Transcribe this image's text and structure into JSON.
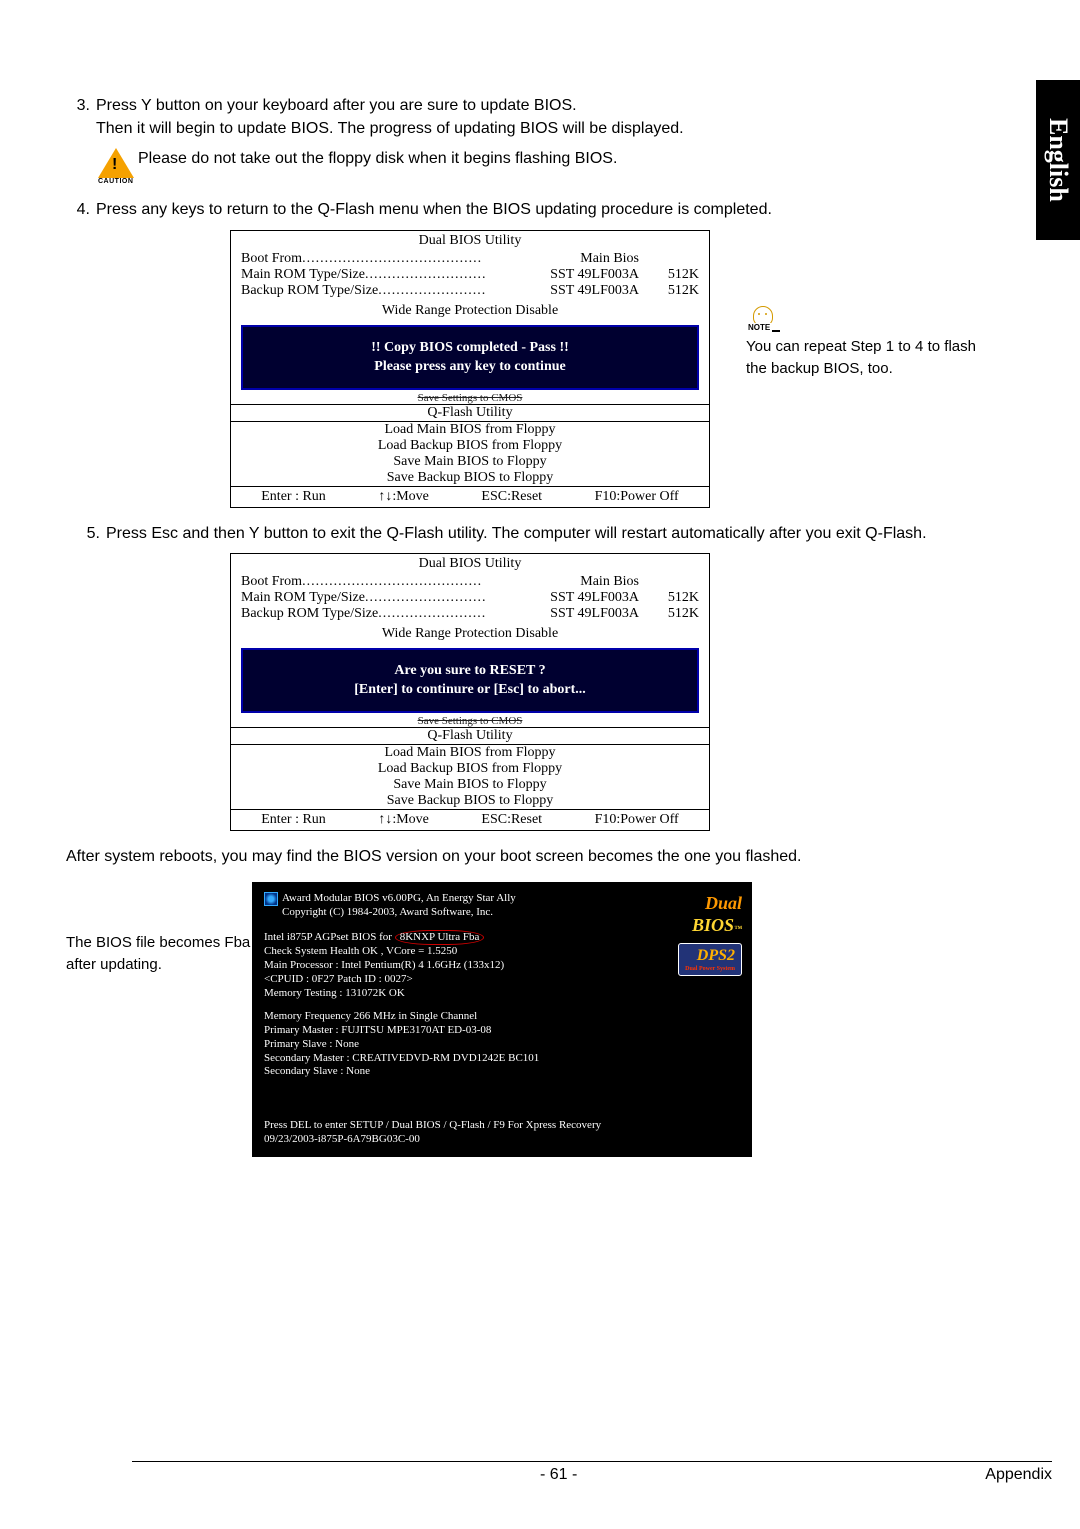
{
  "sideTab": "English",
  "steps": {
    "s3": {
      "num": "3.",
      "text": "Press Y button on your keyboard after you are sure to update BIOS.\nThen it will begin to update BIOS. The progress of updating BIOS will be displayed."
    },
    "caution": "Please do not take out the floppy disk when it begins flashing BIOS.",
    "cautionLabel": "CAUTION",
    "s4": {
      "num": "4.",
      "text": "Press any keys to return to the Q-Flash menu when the BIOS updating procedure is completed."
    },
    "s5": {
      "num": "5.",
      "text": "Press Esc and then Y button to exit the Q-Flash utility. The computer will restart automatically after you exit Q-Flash."
    }
  },
  "bios": {
    "title": "Dual BIOS Utility",
    "boot": {
      "l": "Boot From",
      "c": "Main Bios"
    },
    "main": {
      "l": "Main ROM Type/Size",
      "c": "SST 49LF003A",
      "r": "512K"
    },
    "backup": {
      "l": "Backup ROM Type/Size",
      "c": "SST 49LF003A",
      "r": "512K"
    },
    "wrp": "Wide Range Protection    Disable",
    "banner1": {
      "a": "!! Copy BIOS completed - Pass !!",
      "b": "Please press any key to continue"
    },
    "banner2": {
      "a": "Are you sure to RESET ?",
      "b": "[Enter] to continure or [Esc] to abort..."
    },
    "strike": "Save Settings to CMOS",
    "qflash": "Q-Flash Utility",
    "m1": "Load Main BIOS from Floppy",
    "m2": "Load Backup BIOS from Floppy",
    "m3": "Save Main BIOS to Floppy",
    "m4": "Save Backup BIOS to Floppy",
    "f": {
      "a": "Enter : Run",
      "b": "↑↓:Move",
      "c": "ESC:Reset",
      "d": "F10:Power Off"
    }
  },
  "note": {
    "label": "NOTE",
    "text": "You can repeat Step 1 to 4 to flash the backup BIOS, too."
  },
  "afterPara": "After system reboots, you may find the BIOS version on your boot screen becomes the one you flashed.",
  "bootLabel": "The BIOS file becomes Fba after updating.",
  "boot": {
    "l1": "Award Modular BIOS v6.00PG, An Energy Star Ally",
    "l2": "Copyright (C) 1984-2003, Award Software, Inc.",
    "l3a": "Intel i875P AGPset BIOS for",
    "l3b": "8KNXP Ultra Fba",
    "l3c": "",
    "l4": "Check System Health OK , VCore = 1.5250",
    "l5": "Main Processor : Intel Pentium(R) 4  1.6GHz (133x12)",
    "l6": "<CPUID : 0F27 Patch ID : 0027>",
    "l7": "Memory Testing  : 131072K OK",
    "l8": "Memory Frequency 266 MHz in Single Channel",
    "l9": "Primary Master : FUJITSU MPE3170AT ED-03-08",
    "l10": "Primary Slave : None",
    "l11": "Secondary Master : CREATIVEDVD-RM DVD1242E BC101",
    "l12": "Secondary Slave : None",
    "l13": "Press DEL to enter SETUP / Dual BIOS / Q-Flash / F9 For Xpress Recovery",
    "l14": "09/23/2003-i875P-6A79BG03C-00",
    "logo1a": "Dual",
    "logo1b": "BIOS",
    "logo2": "DPS2",
    "logo2sub": "Dual Power System"
  },
  "footer": {
    "page": "- 61 -",
    "section": "Appendix"
  }
}
